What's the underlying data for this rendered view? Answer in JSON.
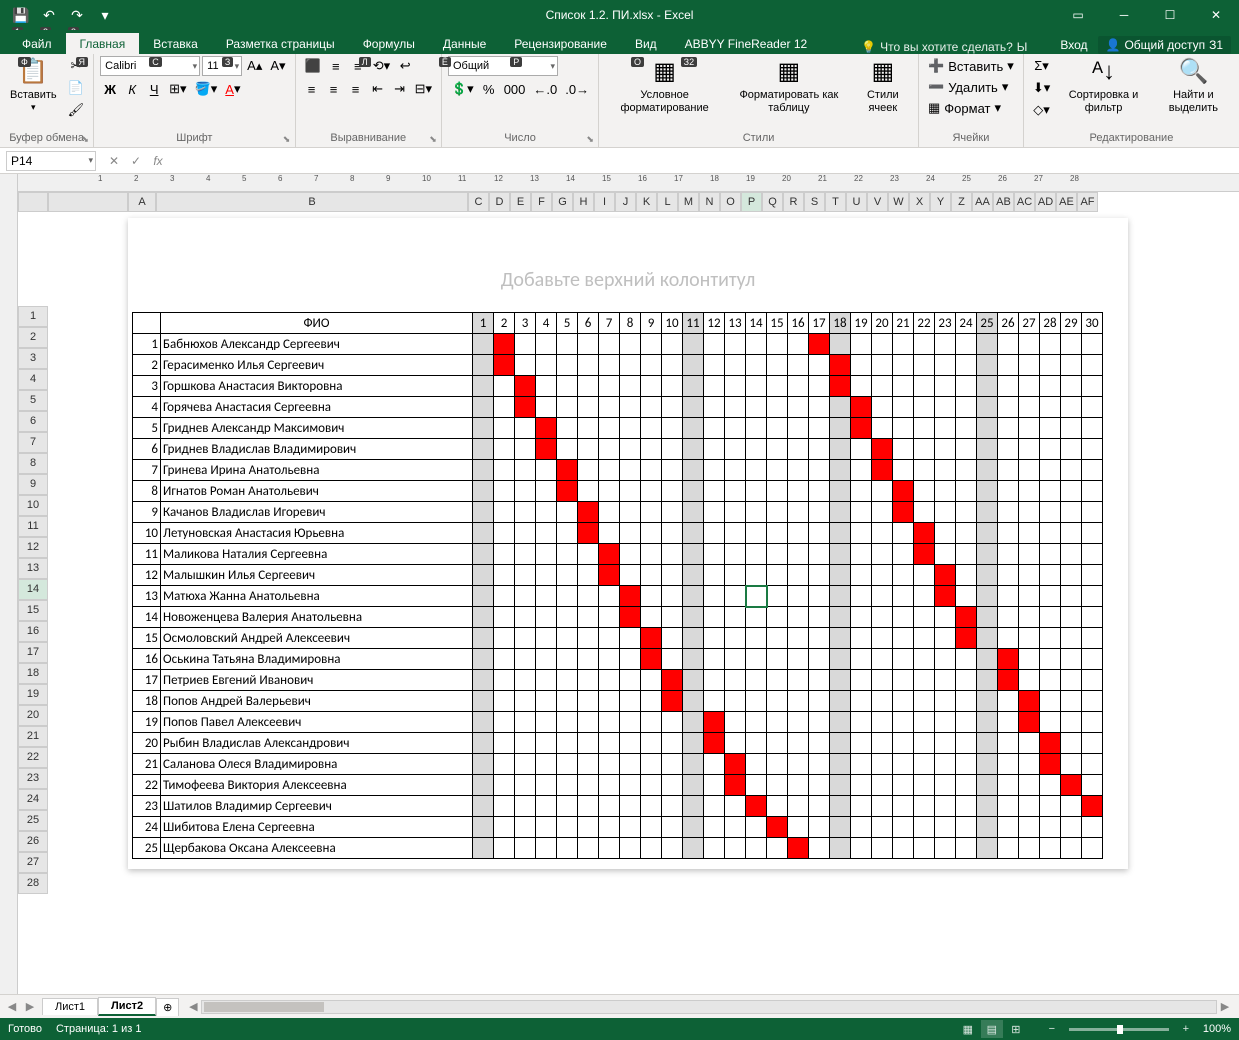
{
  "window": {
    "title": "Список 1.2. ПИ.xlsx - Excel",
    "qat_save": "💾",
    "qat_undo": "↶",
    "qat_redo": "↷"
  },
  "tabs": {
    "file": "Файл",
    "home": "Главная",
    "insert": "Вставка",
    "pagelayout": "Разметка страницы",
    "formulas": "Формулы",
    "data": "Данные",
    "review": "Рецензирование",
    "view": "Вид",
    "abbyy": "ABBYY FineReader 12",
    "tellme": "Что вы хотите сделать?",
    "signin": "Вход",
    "share": "Общий доступ",
    "keys": {
      "file": "Ф",
      "home": "Я",
      "insert": "С",
      "pagelayout": "З",
      "formulas": "Л",
      "data": "Ё",
      "review": "Р",
      "view": "О",
      "abbyy": "З2",
      "tellme": "Ы",
      "share": "З1",
      "qat1": "1",
      "qat2": "2",
      "qat3": "3"
    }
  },
  "ribbon": {
    "clipboard": {
      "paste": "Вставить",
      "label": "Буфер обмена"
    },
    "font": {
      "name": "Calibri",
      "size": "11",
      "bold": "Ж",
      "italic": "К",
      "underline": "Ч",
      "label": "Шрифт"
    },
    "align": {
      "label": "Выравнивание"
    },
    "number": {
      "format": "Общий",
      "label": "Число"
    },
    "styles": {
      "cond": "Условное форматирование",
      "table": "Форматировать как таблицу",
      "cell": "Стили ячеек",
      "label": "Стили"
    },
    "cells": {
      "insert": "Вставить",
      "delete": "Удалить",
      "format": "Формат",
      "label": "Ячейки"
    },
    "editing": {
      "sort": "Сортировка и фильтр",
      "find": "Найти и выделить",
      "label": "Редактирование"
    }
  },
  "namebox": "P14",
  "header_placeholder": "Добавьте верхний колонтитул",
  "columns_main": [
    "A",
    "B",
    "C",
    "D",
    "E",
    "F",
    "G",
    "H",
    "I",
    "J",
    "K",
    "L",
    "M",
    "N",
    "O",
    "P",
    "Q",
    "R",
    "S",
    "T",
    "U",
    "V",
    "W",
    "X",
    "Y",
    "Z",
    "AA",
    "AB",
    "AC",
    "AD",
    "AE",
    "AF"
  ],
  "selected_col_index": 15,
  "selected_row": 14,
  "table": {
    "fio_header": "ФИО",
    "days": [
      1,
      2,
      3,
      4,
      5,
      6,
      7,
      8,
      9,
      10,
      11,
      12,
      13,
      14,
      15,
      16,
      17,
      18,
      19,
      20,
      21,
      22,
      23,
      24,
      25,
      26,
      27,
      28,
      29,
      30
    ],
    "gray_cols": [
      1,
      11,
      18,
      25
    ],
    "rows": [
      {
        "n": 1,
        "name": "Бабнюхов Александр Сергеевич",
        "red": [
          2,
          17
        ]
      },
      {
        "n": 2,
        "name": "Герасименко Илья Сергеевич",
        "red": [
          2,
          18
        ]
      },
      {
        "n": 3,
        "name": "Горшкова Анастасия Викторовна",
        "red": [
          3,
          18
        ]
      },
      {
        "n": 4,
        "name": "Горячева Анастасия Сергеевна",
        "red": [
          3,
          19
        ]
      },
      {
        "n": 5,
        "name": "Гриднев Александр Максимович",
        "red": [
          4,
          19
        ]
      },
      {
        "n": 6,
        "name": "Гриднев Владислав Владимирович",
        "red": [
          4,
          20
        ]
      },
      {
        "n": 7,
        "name": "Гринева Ирина Анатольевна",
        "red": [
          5,
          20
        ]
      },
      {
        "n": 8,
        "name": "Игнатов Роман Анатольевич",
        "red": [
          5,
          21
        ]
      },
      {
        "n": 9,
        "name": "Качанов Владислав Игоревич",
        "red": [
          6,
          21
        ]
      },
      {
        "n": 10,
        "name": "Летуновская Анастасия Юрьевна",
        "red": [
          6,
          22
        ]
      },
      {
        "n": 11,
        "name": "Маликова Наталия Сергеевна",
        "red": [
          7,
          22
        ]
      },
      {
        "n": 12,
        "name": "Малышкин Илья Сергеевич",
        "red": [
          7,
          23
        ]
      },
      {
        "n": 13,
        "name": "Матюха Жанна Анатольевна",
        "red": [
          8,
          23
        ]
      },
      {
        "n": 14,
        "name": "Новоженцева Валерия Анатольевна",
        "red": [
          8,
          24
        ]
      },
      {
        "n": 15,
        "name": "Осмоловский Андрей Алексеевич",
        "red": [
          9,
          24
        ]
      },
      {
        "n": 16,
        "name": "Оськина Татьяна Владимировна",
        "red": [
          9,
          26
        ]
      },
      {
        "n": 17,
        "name": "Петриев Евгений Иванович",
        "red": [
          10,
          26
        ]
      },
      {
        "n": 18,
        "name": "Попов Андрей Валерьевич",
        "red": [
          10,
          27
        ]
      },
      {
        "n": 19,
        "name": "Попов Павел Алексеевич",
        "red": [
          12,
          27
        ]
      },
      {
        "n": 20,
        "name": "Рыбин Владислав Александрович",
        "red": [
          12,
          28
        ]
      },
      {
        "n": 21,
        "name": "Саланова Олеся Владимировна",
        "red": [
          13,
          28
        ]
      },
      {
        "n": 22,
        "name": "Тимофеева Виктория Алексеевна",
        "red": [
          13,
          29
        ]
      },
      {
        "n": 23,
        "name": "Шатилов Владимир Сергеевич",
        "red": [
          14,
          30
        ]
      },
      {
        "n": 24,
        "name": "Шибитова Елена Сергеевна",
        "red": [
          15
        ]
      },
      {
        "n": 25,
        "name": "Щербакова Оксана Алексеевна",
        "red": [
          16
        ]
      }
    ]
  },
  "sheets": {
    "s1": "Лист1",
    "s2": "Лист2",
    "active": "s2"
  },
  "status": {
    "ready": "Готово",
    "page": "Страница: 1 из 1",
    "zoom": "100%"
  }
}
